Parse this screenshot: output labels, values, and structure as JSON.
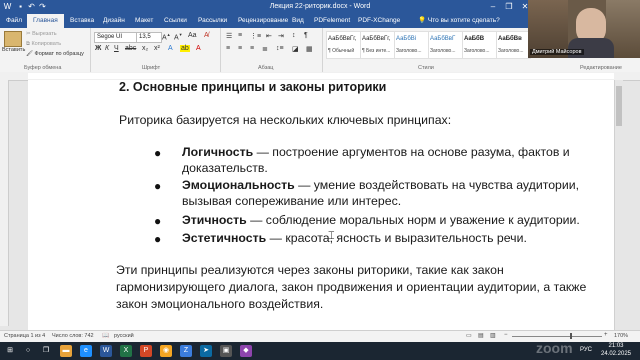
{
  "window": {
    "title": "Лекция 22-риторик.docx - Word",
    "minimize_glyph": "–",
    "restore_glyph": "❐",
    "close_glyph": "✕"
  },
  "tabs": [
    "Файл",
    "Главная",
    "Вставка",
    "Дизайн",
    "Макет",
    "Ссылки",
    "Рассылки",
    "Рецензирование",
    "Вид",
    "PDFelement",
    "PDF-XChange"
  ],
  "active_tab": "Главная",
  "tell_me": "Что вы хотите сделать?",
  "ribbon": {
    "clipboard": {
      "paste": "Вставить",
      "cut": "Вырезать",
      "copy": "Копировать",
      "format_painter": "Формат по образцу",
      "label": "Буфер обмена"
    },
    "font": {
      "name": "Segoe UI",
      "size": "13,5",
      "label": "Шрифт",
      "bold": "Ж",
      "italic": "К",
      "underline": "Ч"
    },
    "paragraph": {
      "label": "Абзац"
    },
    "styles": {
      "label": "Стили",
      "items": [
        {
          "preview": "АаБбВвГг,",
          "name": "¶ Обычный"
        },
        {
          "preview": "АаБбВвГг,",
          "name": "¶ Без инте..."
        },
        {
          "preview": "АаБбВі",
          "name": "Заголово..."
        },
        {
          "preview": "АаБбВвГ",
          "name": "Заголово..."
        },
        {
          "preview": "АаБбВ",
          "name": "Заголово..."
        },
        {
          "preview": "АаБбВв",
          "name": "Заголово..."
        }
      ]
    },
    "editing": {
      "label": "Редактирование"
    }
  },
  "webcam": {
    "name_label": "Дмитрий Майсоров"
  },
  "document": {
    "heading": "2. Основные принципы и законы риторики",
    "intro": "Риторика базируется на нескольких ключевых принципах:",
    "bullets": [
      {
        "term": "Логичность",
        "text": " — построение аргументов на основе разума, фактов и доказательств."
      },
      {
        "term": "Эмоциональность",
        "text": " — умение воздействовать на чувства аудитории, вызывая сопереживание или интерес."
      },
      {
        "term": "Этичность",
        "text": " — соблюдение моральных норм и уважение к аудитории."
      },
      {
        "term": "Эстетичность",
        "text": " — красота, ясность и выразительность речи."
      }
    ],
    "closing": "Эти принципы реализуются через законы риторики, такие как закон гармонизирующего диалога, закон продвижения и ориентации аудитории, а также закон эмоционального воздействия."
  },
  "status": {
    "page": "Страница 1 из 4",
    "words": "Число слов: 742",
    "language": "русский",
    "zoom": "170%"
  },
  "taskbar": {
    "time": "21:03",
    "date": "24.02.2025",
    "lang": "РУС",
    "watermark": "zoom"
  }
}
